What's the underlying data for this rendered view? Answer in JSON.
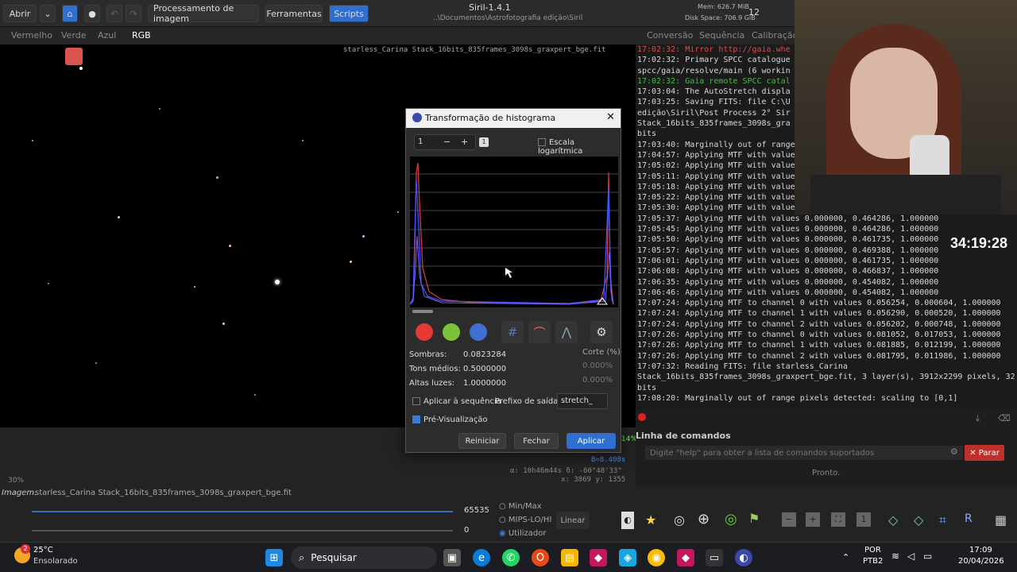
{
  "header": {
    "open_label": "Abrir",
    "processing_menu": "Processamento de imagem",
    "tools_menu": "Ferramentas",
    "scripts_menu": "Scripts",
    "app_title": "Siril-1.4.1",
    "path": "..\\Documentos\\Astrofotografia edição\\Siril",
    "mem": "Mem: 626.7 MiB",
    "disk": "Disk Space: 706.9 GiB",
    "threads": "12"
  },
  "channels": {
    "red": "Vermelho",
    "green": "Verde",
    "blue": "Azul",
    "rgb": "RGB"
  },
  "image": {
    "filename": "starless_Carina Stack_16bits_835frames_3098s_graxpert_bge.fit",
    "zoom": "30%",
    "alpha": "α: 10h46m44s δ: -60°48'33\"",
    "xy": "x: 3869 y: 1355",
    "bw": "B=8.408s",
    "pct": "14%"
  },
  "right_tabs": {
    "conversion": "Conversão",
    "sequence": "Sequência",
    "calibration": "Calibração"
  },
  "log_lines": [
    "17:02:32: Mirror http://gaia.whe",
    "17:02:32: Primary SPCC catalogue",
    "spcc/gaia/resolve/main (6 workin",
    "17:02:32: Gaia remote SPCC catal",
    "17:03:04: The AutoStretch displa",
    "17:03:25: Saving FITS: file C:\\U",
    "edição\\Siril\\Post Process 2° Sir",
    "Stack_16bits_835frames_3098s_gra",
    "bits",
    "17:03:40: Marginally out of range",
    "17:04:57: Applying MTF with value",
    "17:05:02: Applying MTF with value",
    "17:05:11: Applying MTF with value",
    "17:05:18: Applying MTF with value",
    "17:05:22: Applying MTF with value",
    "17:05:30: Applying MTF with value",
    "17:05:37: Applying MTF with values 0.000000, 0.464286, 1.000000",
    "17:05:45: Applying MTF with values 0.000000, 0.464286, 1.000000",
    "17:05:50: Applying MTF with values 0.000000, 0.461735, 1.000000",
    "17:05:57: Applying MTF with values 0.000000, 0.469388, 1.000000",
    "17:06:01: Applying MTF with values 0.000000, 0.461735, 1.000000",
    "17:06:08: Applying MTF with values 0.000000, 0.466837, 1.000000",
    "17:06:35: Applying MTF with values 0.000000, 0.454082, 1.000000",
    "17:06:46: Applying MTF with values 0.000000, 0.454082, 1.000000",
    "17:07:24: Applying MTF to channel 0 with values 0.056254, 0.000604, 1.000000",
    "17:07:24: Applying MTF to channel 1 with values 0.056290, 0.000520, 1.000000",
    "17:07:24: Applying MTF to channel 2 with values 0.056202, 0.000748, 1.000000",
    "17:07:26: Applying MTF to channel 0 with values 0.081052, 0.017053, 1.000000",
    "17:07:26: Applying MTF to channel 1 with values 0.081885, 0.012199, 1.000000",
    "17:07:26: Applying MTF to channel 2 with values 0.081795, 0.011986, 1.000000",
    "17:07:32: Reading FITS: file starless_Carina",
    "Stack_16bits_835frames_3098s_graxpert_bge.fit, 3 layer(s), 3912x2299 pixels, 32",
    "bits",
    "17:08:20: Marginally out of range pixels detected: scaling to [0,1]"
  ],
  "timer": "34:19:28",
  "cmd": {
    "title": "Linha de comandos",
    "placeholder": "Digite \"help\" para obter a lista de comandos suportados",
    "stop": "Parar",
    "status": "Pronto."
  },
  "bottom": {
    "image_label": "Imagem:",
    "image_name": "starless_Carina Stack_16bits_835frames_3098s_graxpert_bge.fit",
    "max": "65535",
    "min": "0",
    "minmax": "Min/Max",
    "mips": "MIPS-LO/HI",
    "user": "Utilizador",
    "scale": "Linear"
  },
  "dialog": {
    "title": "Transformação de histograma",
    "zoom_value": "1",
    "log_scale": "Escala logarítmica",
    "shadows_label": "Sombras:",
    "shadows": "0.0823284",
    "mid_label": "Tons médios:",
    "mid": "0.5000000",
    "high_label": "Altas luzes:",
    "high": "1.0000000",
    "cut_label": "Corte (%)",
    "cut_low": "0.000%",
    "cut_high": "0.000%",
    "apply_seq": "Aplicar à sequência",
    "prefix_label": "Prefixo de saída:",
    "prefix": "stretch_",
    "preview": "Pré-Visualização",
    "reset": "Reiniciar",
    "close": "Fechar",
    "apply": "Aplicar"
  },
  "taskbar": {
    "temp": "25°C",
    "weather": "Ensolarado",
    "weather_badge": "2",
    "search": "Pesquisar",
    "lang": "POR",
    "layout": "PTB2",
    "time": "17:09",
    "date": "20/04/2026"
  },
  "colors": {
    "accent": "#2f6fd0",
    "stop": "#c0302b"
  }
}
